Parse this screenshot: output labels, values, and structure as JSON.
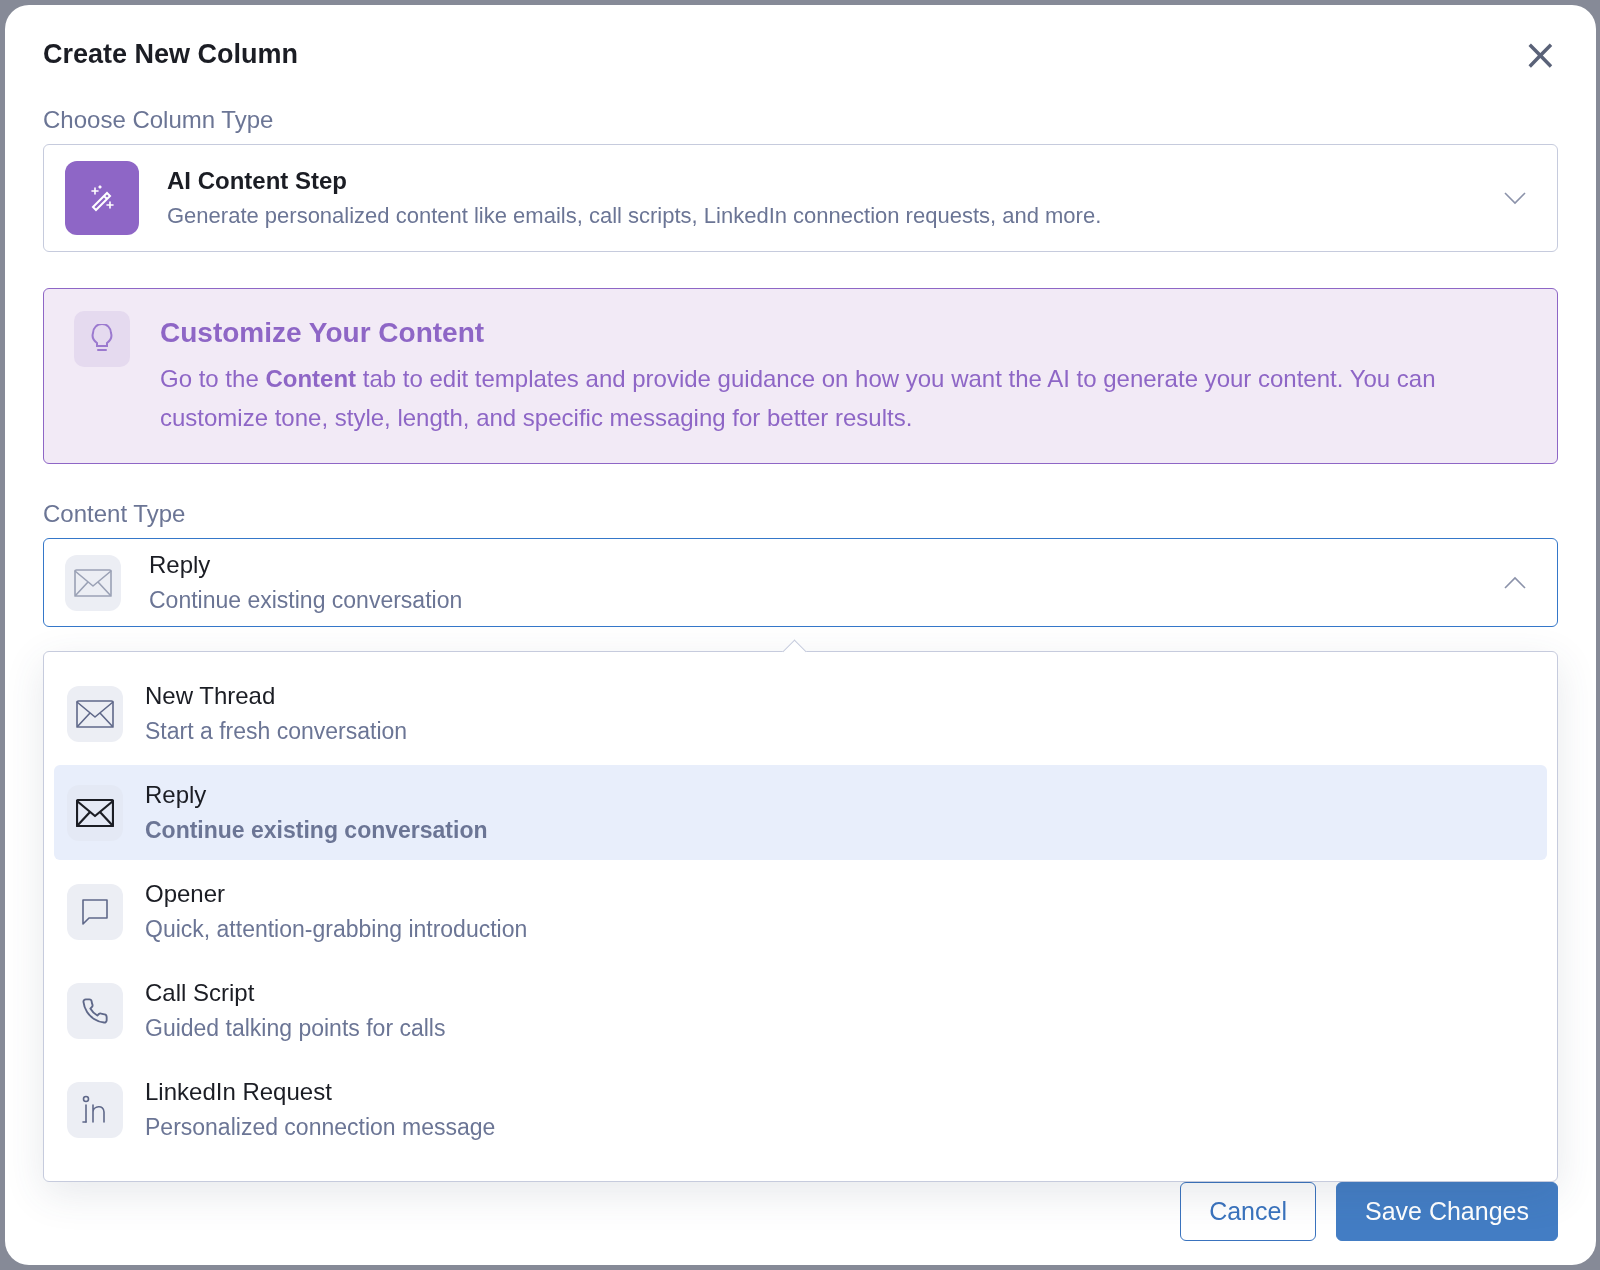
{
  "dialog": {
    "title": "Create New Column",
    "close_label": "×"
  },
  "column_type": {
    "label": "Choose Column Type",
    "title": "AI Content Step",
    "description": "Generate personalized content like emails, call scripts, LinkedIn connection requests, and more.",
    "expanded": false
  },
  "tip": {
    "title": "Customize Your Content",
    "text": "Go to the **Content** tab to edit templates and provide guidance on how you want the AI to generate your content. You can customize tone, style, length, and specific messaging for better results."
  },
  "content_type": {
    "label": "Content Type",
    "kind": "mail",
    "title": "Reply",
    "description": "Continue existing conversation",
    "expanded": true
  },
  "options": [
    {
      "kind": "mail",
      "title": "New Thread",
      "description": "Start a fresh conversation",
      "selected": false
    },
    {
      "kind": "mail",
      "title": "Reply",
      "description": "Continue existing conversation",
      "selected": true
    },
    {
      "kind": "chat",
      "title": "Opener",
      "description": "Quick, attention-grabbing introduction",
      "selected": false
    },
    {
      "kind": "phone",
      "title": "Call Script",
      "description": "Guided talking points for calls",
      "selected": false
    },
    {
      "kind": "linkedin",
      "title": "LinkedIn Request",
      "description": "Personalized connection message",
      "selected": false
    }
  ],
  "buttons": {
    "cancel": "Cancel",
    "save": "Save Changes"
  }
}
